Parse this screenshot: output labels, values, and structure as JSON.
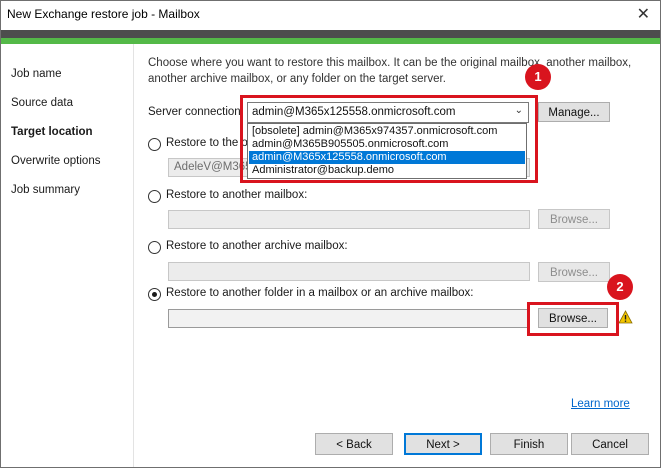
{
  "window": {
    "title": "New Exchange restore job - Mailbox",
    "close_glyph": "✕"
  },
  "sidebar": {
    "items": [
      {
        "label": "Job name"
      },
      {
        "label": "Source data"
      },
      {
        "label": "Target location"
      },
      {
        "label": "Overwrite options"
      },
      {
        "label": "Job summary"
      }
    ],
    "active_index": 2
  },
  "main": {
    "description": "Choose where you want to restore this mailbox. It can be the original mailbox, another mailbox, another archive mailbox, or any folder on the target server.",
    "server_connection": {
      "label": "Server connection:",
      "selected": "admin@M365x125558.onmicrosoft.com",
      "manage_label": "Manage...",
      "options": [
        "[obsolete] admin@M365x974357.onmicrosoft.com",
        "admin@M365B905505.onmicrosoft.com",
        "admin@M365x125558.onmicrosoft.com",
        "Administrator@backup.demo"
      ],
      "highlighted_option_index": 2
    },
    "restore_original": {
      "label_visible": "Restore to the ori",
      "field_value_visible": "AdeleV@M365x"
    },
    "restore_another_mailbox": {
      "label": "Restore to another mailbox:",
      "browse_label": "Browse..."
    },
    "restore_another_archive": {
      "label": "Restore to another archive mailbox:",
      "browse_label": "Browse..."
    },
    "restore_folder": {
      "label": "Restore to another folder in a mailbox or an archive mailbox:",
      "browse_label": "Browse...",
      "field_value": ""
    },
    "learn_more": "Learn more"
  },
  "footer": {
    "back_label": "< Back",
    "next_label": "Next >",
    "finish_label": "Finish",
    "cancel_label": "Cancel"
  },
  "annotations": {
    "badge1": "1",
    "badge2": "2",
    "color": "#d9141e"
  },
  "colors": {
    "accent_green": "#54b948",
    "selection_blue": "#0078d7",
    "link_blue": "#0066cc"
  }
}
